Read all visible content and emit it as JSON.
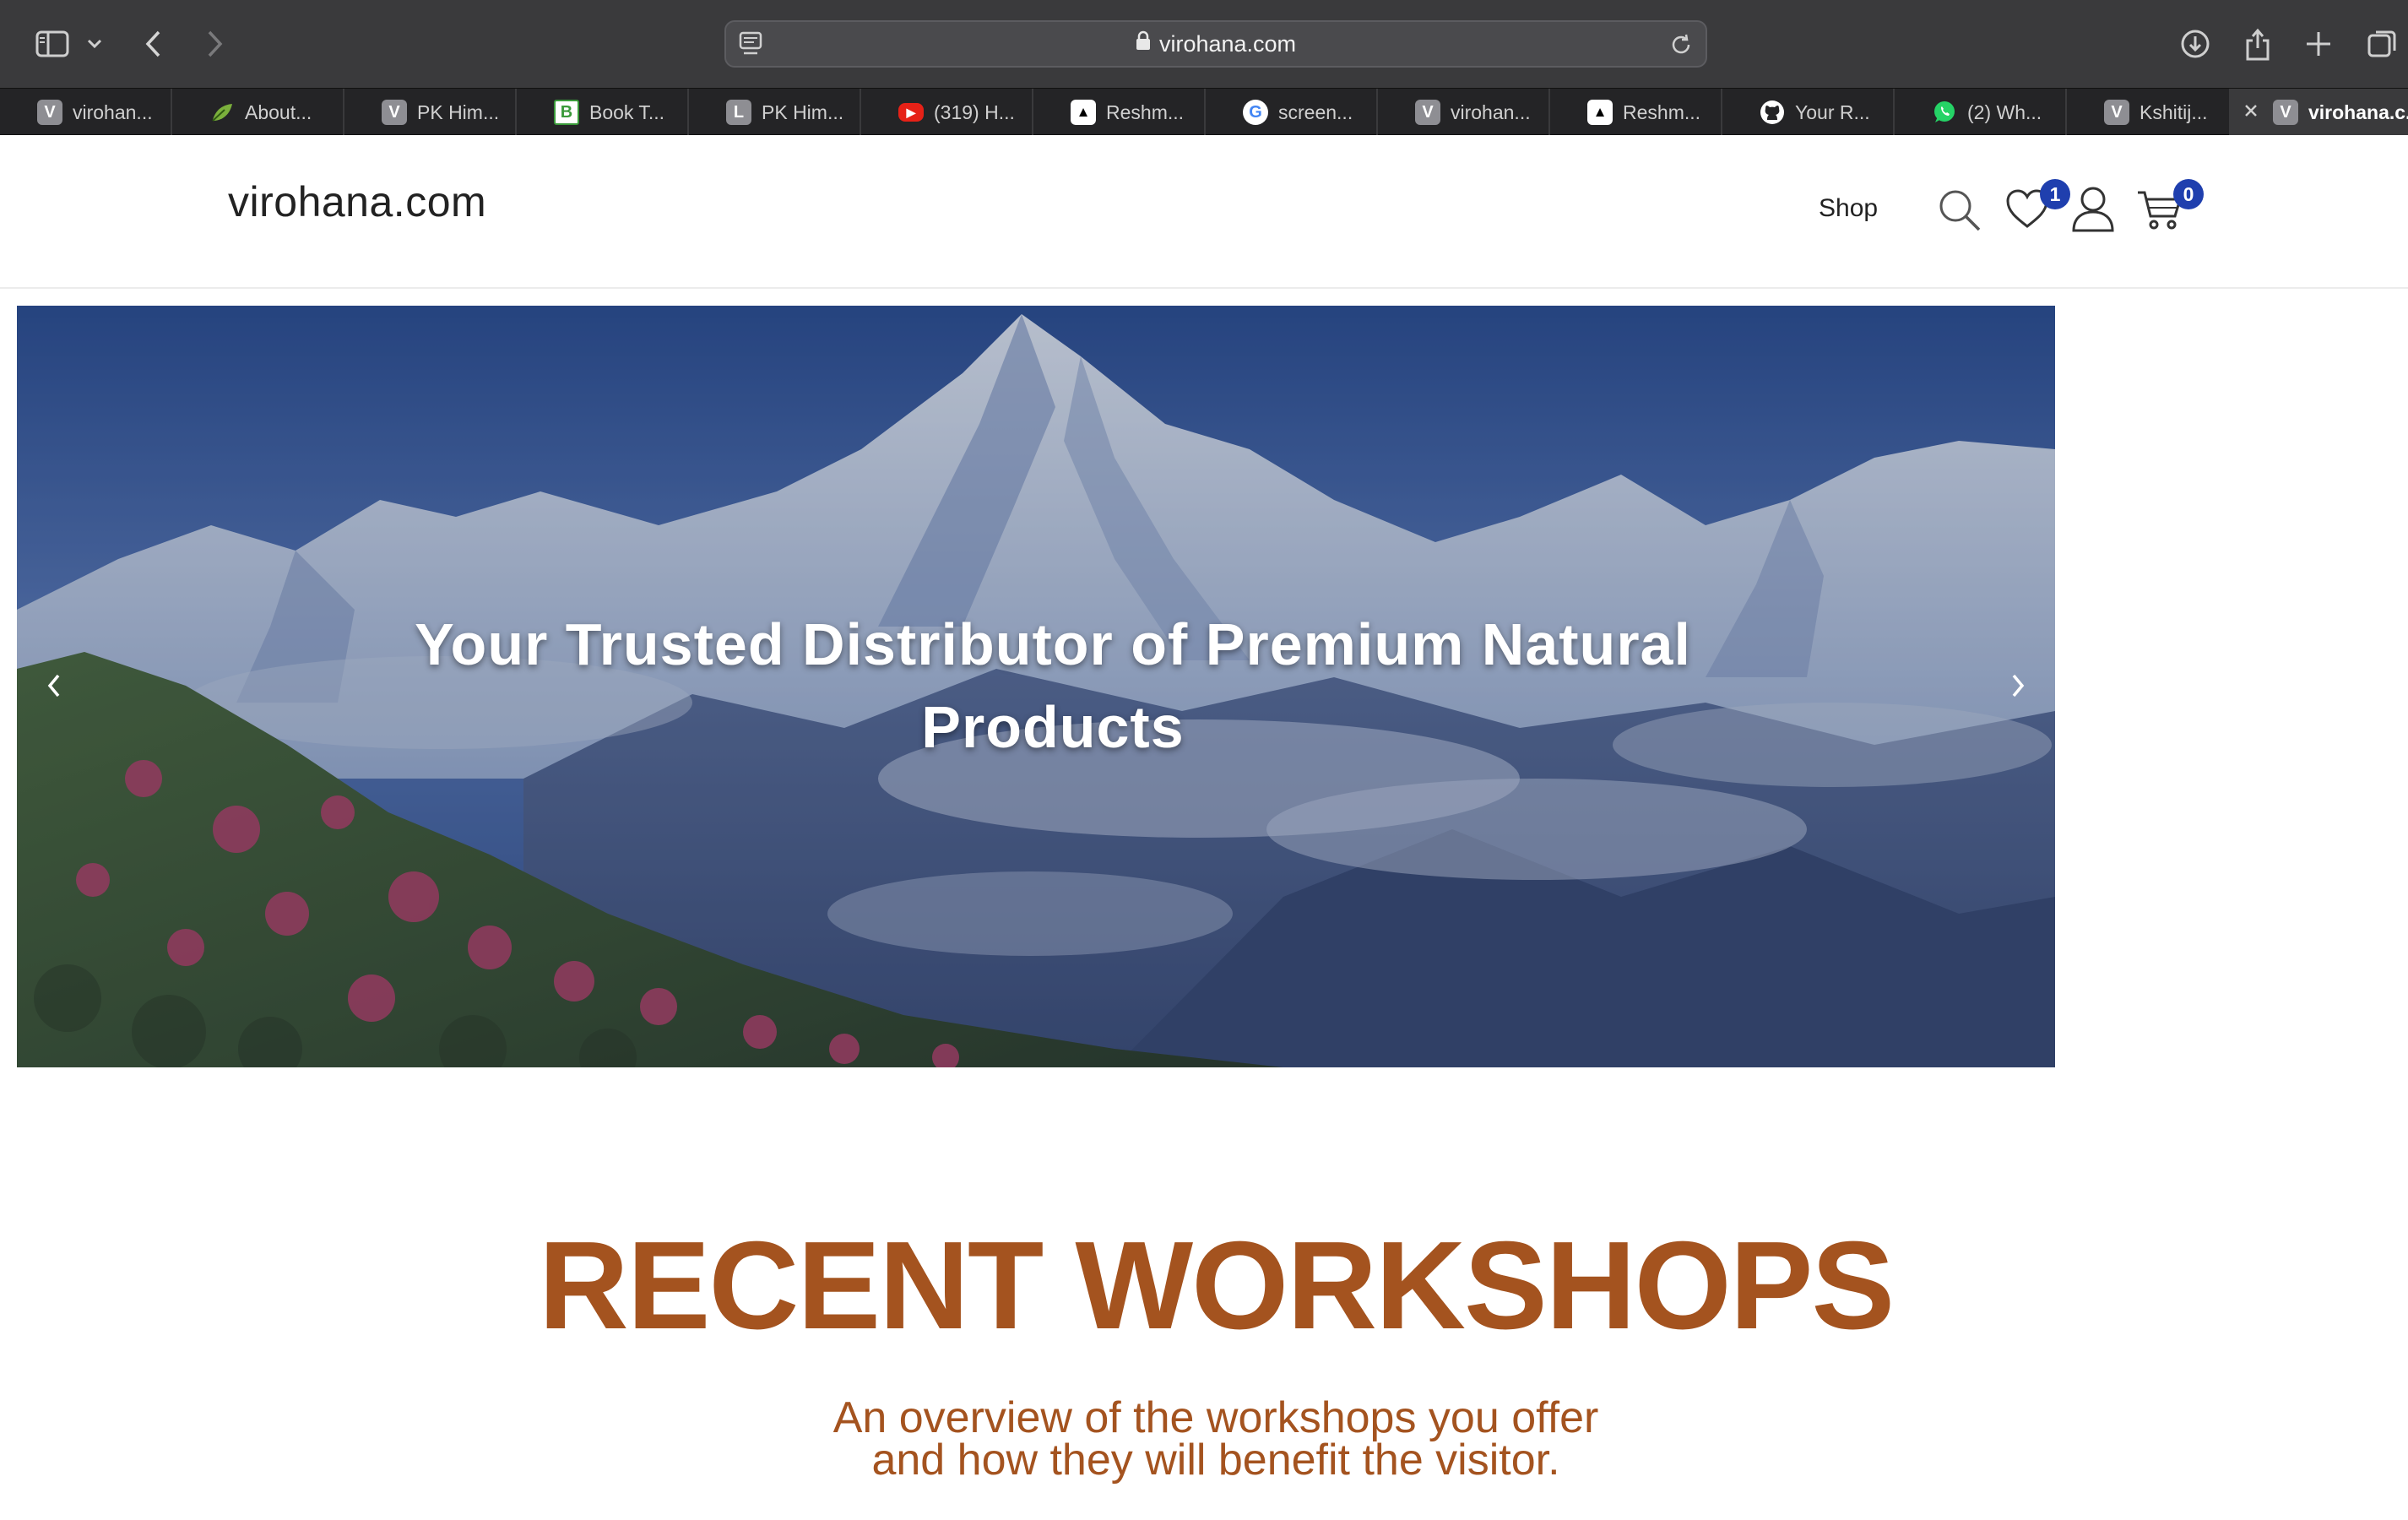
{
  "browser": {
    "address": "virohana.com",
    "tabs": [
      {
        "favicon_letter": "V",
        "favicon_color": "#8e8e93",
        "label": "virohan..."
      },
      {
        "favicon_letter": "",
        "favicon_color": "",
        "label": "About..."
      },
      {
        "favicon_letter": "V",
        "favicon_color": "#8e8e93",
        "label": "PK Him..."
      },
      {
        "favicon_letter": "B",
        "favicon_color": "#3a9a3a",
        "label": "Book T..."
      },
      {
        "favicon_letter": "L",
        "favicon_color": "#8e8e93",
        "label": "PK Him..."
      },
      {
        "favicon_letter": "▶",
        "favicon_color": "#e62117",
        "label": "(319) H..."
      },
      {
        "favicon_letter": "▲",
        "favicon_color": "#ffffff",
        "label": "Reshm..."
      },
      {
        "favicon_letter": "G",
        "favicon_color": "#ffffff",
        "label": "screen..."
      },
      {
        "favicon_letter": "V",
        "favicon_color": "#8e8e93",
        "label": "virohan..."
      },
      {
        "favicon_letter": "▲",
        "favicon_color": "#ffffff",
        "label": "Reshm..."
      },
      {
        "favicon_letter": "",
        "favicon_color": "#ffffff",
        "label": "Your R..."
      },
      {
        "favicon_letter": "",
        "favicon_color": "#25d366",
        "label": "(2) Wh..."
      },
      {
        "favicon_letter": "V",
        "favicon_color": "#8e8e93",
        "label": "Kshitij..."
      },
      {
        "favicon_letter": "V",
        "favicon_color": "#8e8e93",
        "label": "virohana.c..."
      }
    ]
  },
  "site": {
    "logo": "virohana.com",
    "nav": {
      "shop": "Shop"
    },
    "wishlist_count": "1",
    "cart_count": "0",
    "accent_color": "#1f3fae"
  },
  "hero": {
    "title": "Your Trusted Distributor of Premium Natural Products"
  },
  "workshops": {
    "title": "RECENT WORKSHOPS",
    "subtitle_line1": "An overview of the workshops you offer",
    "subtitle_line2": "and how they will benefit the visitor.",
    "color": "#a4531f"
  }
}
